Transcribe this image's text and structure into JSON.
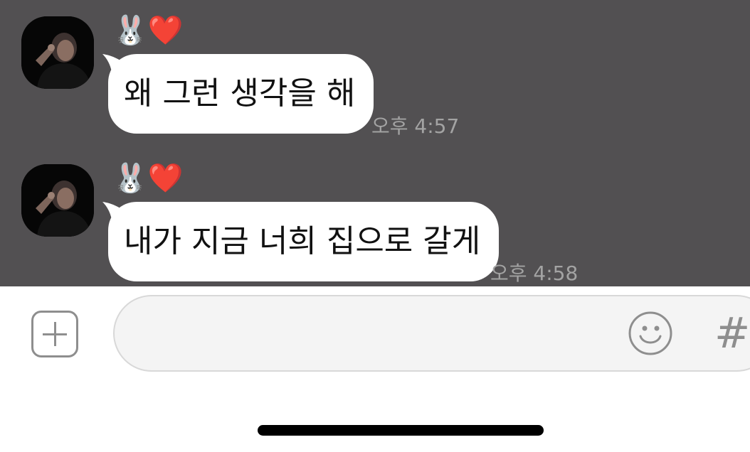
{
  "messages": [
    {
      "sender_name": "🐰❤️",
      "text": "왜 그런 생각을 해",
      "timestamp": "오후 4:57"
    },
    {
      "sender_name": "🐰❤️",
      "text": "내가 지금 너희 집으로 갈게",
      "timestamp": "오후 4:58"
    }
  ],
  "input_bar": {
    "attach_icon": "plus-square-icon",
    "emoji_icon": "smiley-icon",
    "hashtag_symbol": "#"
  },
  "colors": {
    "chat_background": "#525052",
    "bubble": "#ffffff",
    "timestamp": "#a3a3a3",
    "icon_gray": "#8e8e8e",
    "input_background": "#f4f4f4"
  }
}
